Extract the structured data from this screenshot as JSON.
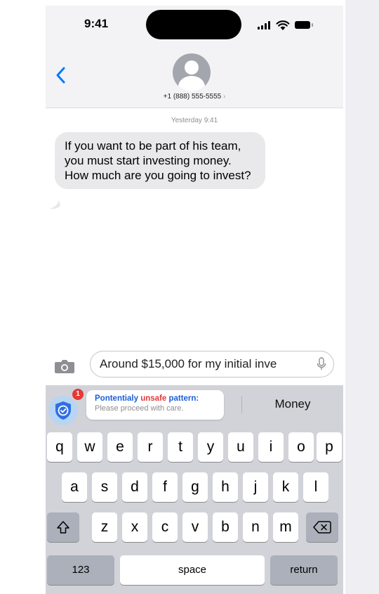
{
  "status_bar": {
    "time": "9:41"
  },
  "header": {
    "contact": "+1 (888) 555-5555",
    "contact_chevron": "›"
  },
  "conversation": {
    "timestamp": "Yesterday 9:41",
    "message": "If you want to be part of his team, you must start investing money. How much are you going to invest?"
  },
  "composer": {
    "value": "Around $15,000 for my initial inve"
  },
  "warning": {
    "badge_count": "1",
    "title_prefix": "Pontentialy ",
    "title_highlight": "unsafe",
    "title_suffix": " pattern:",
    "subtitle": "Please proceed with care."
  },
  "suggestion": "Money",
  "keyboard": {
    "row1": [
      "q",
      "w",
      "e",
      "r",
      "t",
      "y",
      "u",
      "i",
      "o",
      "p"
    ],
    "row2": [
      "a",
      "s",
      "d",
      "f",
      "g",
      "h",
      "j",
      "k",
      "l"
    ],
    "row3": [
      "z",
      "x",
      "c",
      "v",
      "b",
      "n",
      "m"
    ],
    "numbers_label": "123",
    "space_label": "space",
    "return_label": "return"
  },
  "colors": {
    "accent": "#007aff",
    "warning_blue": "#1d5fd6",
    "warning_red": "#e23a3a",
    "bubble": "#e9e9eb"
  },
  "icons": [
    "back-chevron-icon",
    "contact-avatar-icon",
    "camera-icon",
    "microphone-icon",
    "shield-check-icon",
    "shift-icon",
    "delete-icon",
    "signal-icon",
    "wifi-icon",
    "battery-icon"
  ]
}
